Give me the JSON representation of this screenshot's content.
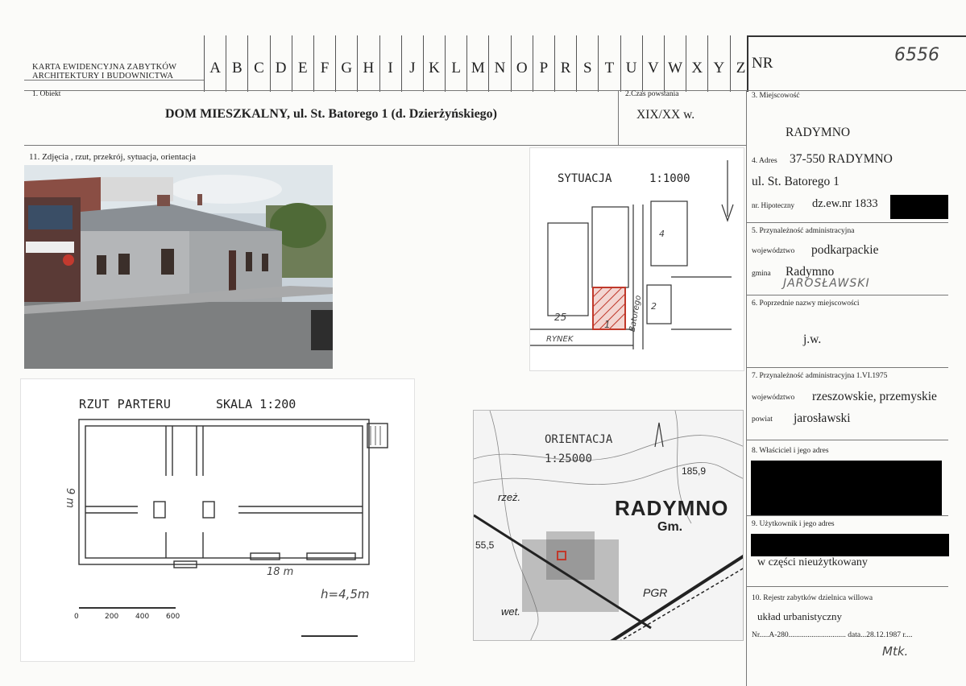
{
  "header": {
    "card_title_line1": "KARTA EWIDENCYJNA ZABYTKÓW",
    "card_title_line2": "ARCHITEKTURY I BUDOWNICTWA",
    "letters": [
      "A",
      "B",
      "C",
      "D",
      "E",
      "F",
      "G",
      "H",
      "I",
      "J",
      "K",
      "L",
      "M",
      "N",
      "O",
      "P",
      "R",
      "S",
      "T",
      "U",
      "V",
      "W",
      "X",
      "Y",
      "Z"
    ],
    "nr_label": "NR",
    "nr_value": "6556"
  },
  "obiekt": {
    "label": "1. Obiekt",
    "value": "DOM MIESZKALNY, ul. St. Batorego 1 (d. Dzierżyńskiego)"
  },
  "czas": {
    "label": "2.Czas powstania",
    "value": "XIX/XX w."
  },
  "miejscowosc": {
    "label": "3. Miejscowość",
    "value": "RADYMNO"
  },
  "photos_label": "11. Zdjęcia , rzut, przekrój, sytuacja, orientacja",
  "adres": {
    "label": "4. Adres",
    "value_line1": "37-550 RADYMNO",
    "value_line2": "ul. St. Batorego 1",
    "hip_label": "nr. Hipoteczny",
    "hip_value": "dz.ew.nr 1833"
  },
  "przynaleznosc": {
    "label": "5. Przynależność administracyjna",
    "woj_label": "województwo",
    "woj_value": "podkarpackie",
    "gmina_label": "gmina",
    "gmina_value": "Radymno",
    "gmina_hand": "JAROSŁAWSKI"
  },
  "poprzednie": {
    "label": "6. Poprzednie nazwy miejscowości",
    "value": "j.w."
  },
  "przyn1975": {
    "label": "7. Przynależność administracyjna 1.VI.1975",
    "woj_label": "województwo",
    "woj_value": "rzeszowskie, przemyskie",
    "powiat_label": "powiat",
    "powiat_value": "jarosławski"
  },
  "wlasciciel": {
    "label": "8. Właściciel i jego adres"
  },
  "uzytkownik": {
    "label": "9. Użytkownik i jego adres",
    "value": "w części nieużytkowany"
  },
  "rejestr": {
    "label": "10. Rejestr zabytków dzielnica willowa",
    "value": "układ urbanistyczny",
    "nr_line": "Nr.....A-280.............................. data...28.12.1987 r....",
    "signature": "Mtk."
  },
  "plan": {
    "title": "RZUT PARTERU",
    "scale": "SKALA 1:200",
    "width_dim": "18 m",
    "depth_dim": "9 m",
    "height_note": "h=4,5m",
    "scale_ticks": [
      "0",
      "200",
      "400",
      "600"
    ]
  },
  "situation": {
    "title": "SYTUACJA",
    "scale": "1:1000",
    "labels": [
      "25",
      "1",
      "2",
      "4",
      "RYNEK",
      "Batorego"
    ]
  },
  "orientation": {
    "title": "ORIENTACJA",
    "scale": "1:25000",
    "town": "RADYMNO",
    "gm": "Gm.",
    "elev": "185,9",
    "other": [
      "PGR",
      "rzeż.",
      "wet.",
      "55,5"
    ]
  },
  "colors": {
    "highlight_red": "#c0392b",
    "redaction": "#000000"
  }
}
